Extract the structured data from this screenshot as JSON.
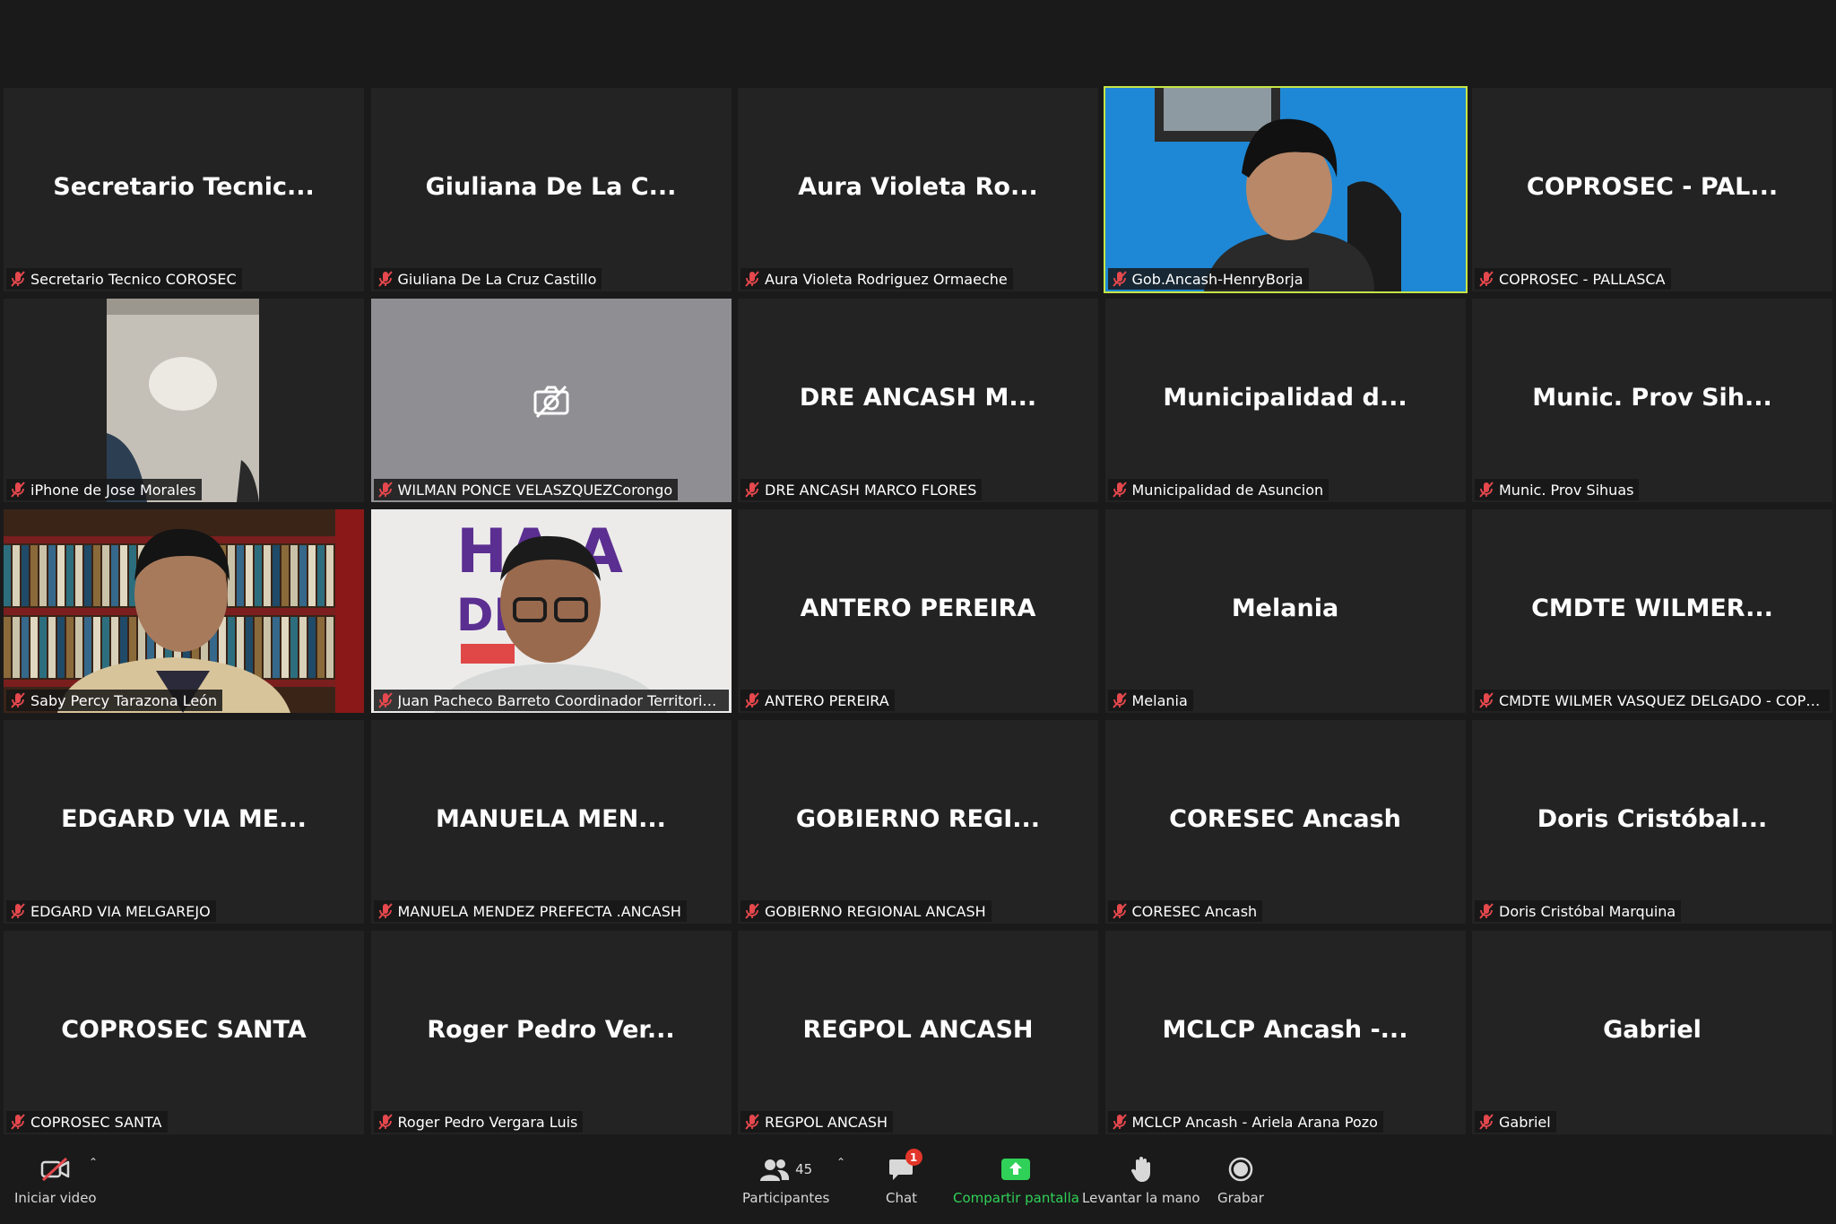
{
  "participants": [
    {
      "display": "Secretario  Tecnic...",
      "label": "Secretario Tecnico COROSEC",
      "kind": "name"
    },
    {
      "display": "Giuliana  De  La  C...",
      "label": "Giuliana De La Cruz Castillo",
      "kind": "name"
    },
    {
      "display": "Aura  Violeta  Ro...",
      "label": "Aura Violeta Rodriguez Ormaeche",
      "kind": "name"
    },
    {
      "display": "",
      "label": "Gob.Ancash-HenryBorja",
      "kind": "video-man-blue",
      "speaking": true
    },
    {
      "display": "COPROSEC  -  PAL...",
      "label": "COPROSEC - PALLASCA",
      "kind": "name"
    },
    {
      "display": "",
      "label": "iPhone de Jose Morales",
      "kind": "video-room"
    },
    {
      "display": "",
      "label": "WILMAN PONCE VELASZQUEZCorongo",
      "kind": "camera-off"
    },
    {
      "display": "DRE  ANCASH  M...",
      "label": "DRE ANCASH MARCO FLORES",
      "kind": "name"
    },
    {
      "display": "Municipalidad  d...",
      "label": "Municipalidad de Asuncion",
      "kind": "name"
    },
    {
      "display": "Munic.  Prov  Sih...",
      "label": "Munic. Prov Sihuas",
      "kind": "name"
    },
    {
      "display": "",
      "label": "Saby Percy Tarazona León",
      "kind": "video-library"
    },
    {
      "display": "",
      "label": "Juan Pacheco Barreto Coordinador Territorial PN...",
      "kind": "video-poster"
    },
    {
      "display": "ANTERO PEREIRA",
      "label": "ANTERO PEREIRA",
      "kind": "name"
    },
    {
      "display": "Melania",
      "label": "Melania",
      "kind": "name"
    },
    {
      "display": "CMDTE  WILMER...",
      "label": "CMDTE WILMER VASQUEZ DELGADO - COPROSE...",
      "kind": "name"
    },
    {
      "display": "EDGARD  VIA  ME...",
      "label": "EDGARD VIA MELGAREJO",
      "kind": "name"
    },
    {
      "display": "MANUELA  MEN...",
      "label": "MANUELA MENDEZ PREFECTA .ANCASH",
      "kind": "name"
    },
    {
      "display": "GOBIERNO  REGI...",
      "label": "GOBIERNO REGIONAL ANCASH",
      "kind": "name"
    },
    {
      "display": "CORESEC Ancash",
      "label": "CORESEC Ancash",
      "kind": "name"
    },
    {
      "display": "Doris  Cristóbal...",
      "label": "Doris Cristóbal Marquina",
      "kind": "name"
    },
    {
      "display": "COPROSEC SANTA",
      "label": "COPROSEC SANTA",
      "kind": "name"
    },
    {
      "display": "Roger  Pedro  Ver...",
      "label": "Roger Pedro Vergara Luis",
      "kind": "name"
    },
    {
      "display": "REGPOL ANCASH",
      "label": "REGPOL ANCASH",
      "kind": "name"
    },
    {
      "display": "MCLCP  Ancash  -...",
      "label": "MCLCP Ancash - Ariela Arana Pozo",
      "kind": "name"
    },
    {
      "display": "Gabriel",
      "label": "Gabriel",
      "kind": "name"
    }
  ],
  "poster_text": {
    "line1": "HA   A",
    "line2": "DIF    A"
  },
  "toolbar": {
    "start_video": "Iniciar video",
    "participants": "Participantes",
    "participants_count": "45",
    "chat": "Chat",
    "chat_badge": "1",
    "share_screen": "Compartir pantalla",
    "raise_hand": "Levantar la mano",
    "record": "Grabar"
  },
  "colors": {
    "speaking_border": "#c6e545",
    "muted_mic": "#e5484d",
    "share_green": "#30d158",
    "badge_red": "#e3362a"
  },
  "icons": {
    "muted": "mic-muted-icon",
    "camera_off": "camera-off-icon",
    "video_off": "video-off-icon",
    "participants": "participants-icon",
    "chat": "chat-icon",
    "share": "share-screen-icon",
    "hand": "raise-hand-icon",
    "record": "record-icon"
  }
}
